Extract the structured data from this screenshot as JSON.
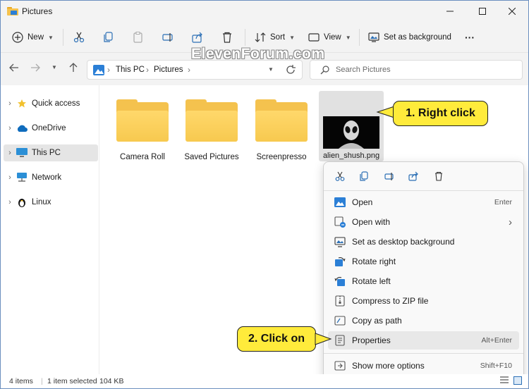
{
  "window": {
    "title": "Pictures"
  },
  "toolbar": {
    "new_label": "New",
    "sort_label": "Sort",
    "view_label": "View",
    "set_bg_label": "Set as background",
    "more_label": "···"
  },
  "address": {
    "crumbs": [
      "This PC",
      "Pictures"
    ],
    "separator": "›",
    "search_placeholder": "Search Pictures"
  },
  "watermark": "ElevenForum.com",
  "sidebar": {
    "items": [
      {
        "label": "Quick access",
        "icon": "star-icon"
      },
      {
        "label": "OneDrive",
        "icon": "cloud-icon"
      },
      {
        "label": "This PC",
        "icon": "monitor-icon",
        "selected": true
      },
      {
        "label": "Network",
        "icon": "network-icon"
      },
      {
        "label": "Linux",
        "icon": "penguin-icon"
      }
    ]
  },
  "files": [
    {
      "label": "Camera Roll",
      "type": "folder"
    },
    {
      "label": "Saved Pictures",
      "type": "folder"
    },
    {
      "label": "Screenpresso",
      "type": "folder"
    },
    {
      "label": "alien_shush.png",
      "type": "image",
      "selected": true
    }
  ],
  "callouts": {
    "right_click": "1. Right click",
    "click_on": "2. Click on",
    "color": "#ffeb3b"
  },
  "context_menu": {
    "icons": [
      "cut-icon",
      "copy-icon",
      "rename-icon",
      "share-icon",
      "delete-icon"
    ],
    "items": [
      {
        "label": "Open",
        "shortcut": "Enter",
        "icon": "image-icon"
      },
      {
        "label": "Open with",
        "shortcut": "›",
        "icon": "open-with-icon"
      },
      {
        "label": "Set as desktop background",
        "shortcut": "",
        "icon": "desktop-bg-icon"
      },
      {
        "label": "Rotate right",
        "shortcut": "",
        "icon": "rotate-right-icon"
      },
      {
        "label": "Rotate left",
        "shortcut": "",
        "icon": "rotate-left-icon"
      },
      {
        "label": "Compress to ZIP file",
        "shortcut": "",
        "icon": "zip-icon"
      },
      {
        "label": "Copy as path",
        "shortcut": "",
        "icon": "copy-path-icon"
      },
      {
        "label": "Properties",
        "shortcut": "Alt+Enter",
        "icon": "properties-icon",
        "hover": true
      },
      {
        "label": "Show more options",
        "shortcut": "Shift+F10",
        "icon": "more-options-icon"
      }
    ]
  },
  "status": {
    "items_count": "4 items",
    "selection": "1 item selected",
    "size": "104 KB"
  },
  "colors": {
    "accent": "#0067c0",
    "folder": "#f4c24e",
    "selection": "#e1e1e1"
  }
}
